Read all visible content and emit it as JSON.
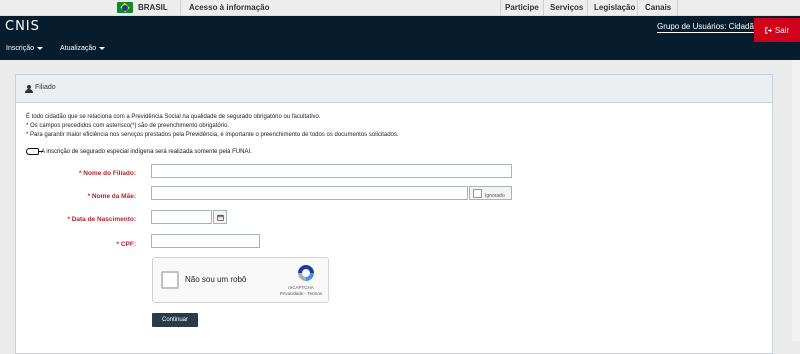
{
  "govbar": {
    "country": "BRASIL",
    "access": "Acesso à informação",
    "links": [
      "Participe",
      "Serviços",
      "Legislação",
      "Canais"
    ]
  },
  "header": {
    "logo": "CNIS",
    "user_group": "Grupo de Usuários: Cidadão",
    "logout": "Sair",
    "menu": [
      "Inscrição",
      "Atualização"
    ]
  },
  "panel": {
    "title": "Filiado",
    "info_lines": [
      "É todo cidadão que se relaciona com a Previdência Social na qualidade de segurado obrigatório ou facultativo.",
      "* Os campos precedidos com asterisco(*) são de preenchimento obrigatório.",
      "* Para garantir maior eficiência nos serviços prestados pela Previdência, é importante o preenchimento de todos os documentos solicitados."
    ],
    "funai_note": "A inscrição de segurado especial indígena será realizada somente pela FUNAI."
  },
  "form": {
    "nome_filiado_label": "* Nome do Filiado:",
    "nome_filiado_value": "",
    "nome_mae_label": "* Nome da Mãe:",
    "nome_mae_value": "",
    "ignorado_label": "Ignorado",
    "nascimento_label": "* Data de Nascimento:",
    "nascimento_value": "",
    "cpf_label": "* CPF:",
    "cpf_value": "",
    "captcha_label": "Não sou um robô",
    "captcha_brand": "reCAPTCHA",
    "captcha_links": "Privacidade - Termos",
    "submit": "Continuar"
  },
  "colors": {
    "header_bg": "#071d2d",
    "logout_bg": "#d0021b",
    "required_label": "#b3262c",
    "button_bg": "#2b3a47"
  }
}
